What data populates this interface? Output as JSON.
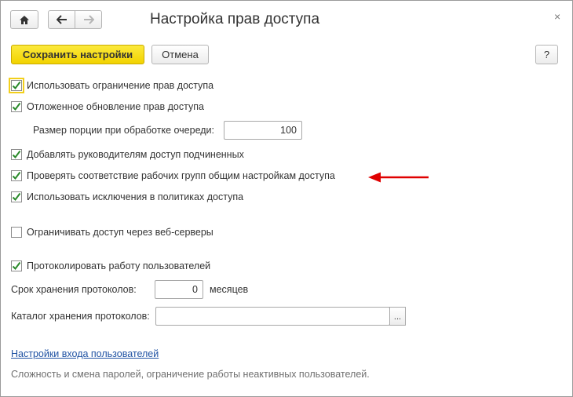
{
  "window": {
    "title": "Настройка прав доступа",
    "close_label": "×"
  },
  "toolbar": {
    "save_label": "Сохранить настройки",
    "cancel_label": "Отмена",
    "help_label": "?"
  },
  "options": {
    "use_restrictions": {
      "label": "Использовать ограничение прав доступа",
      "checked": true
    },
    "deferred_update": {
      "label": "Отложенное обновление прав доступа",
      "checked": true
    },
    "portion_size": {
      "label": "Размер порции при обработке очереди:",
      "value": "100"
    },
    "managers_access": {
      "label": "Добавлять руководителям доступ подчиненных",
      "checked": true
    },
    "check_groups": {
      "label": "Проверять соответствие рабочих групп общим настройкам доступа",
      "checked": true
    },
    "use_exceptions": {
      "label": "Использовать исключения в политиках доступа",
      "checked": true
    },
    "restrict_web": {
      "label": "Ограничивать доступ через веб-серверы",
      "checked": false
    },
    "log_work": {
      "label": "Протоколировать работу пользователей",
      "checked": true
    }
  },
  "log_retention": {
    "label": "Срок хранения протоколов:",
    "value": "0",
    "unit": "месяцев"
  },
  "log_catalog": {
    "label": "Каталог хранения протоколов:",
    "value": "",
    "choose_label": "..."
  },
  "login_settings": {
    "link_label": "Настройки входа пользователей",
    "description": "Сложность и смена паролей, ограничение работы неактивных пользователей."
  },
  "colors": {
    "primary_button": "#f2d300",
    "link": "#1f52a3",
    "checkmark": "#2a8a2a",
    "annotation_arrow": "#e00000"
  }
}
